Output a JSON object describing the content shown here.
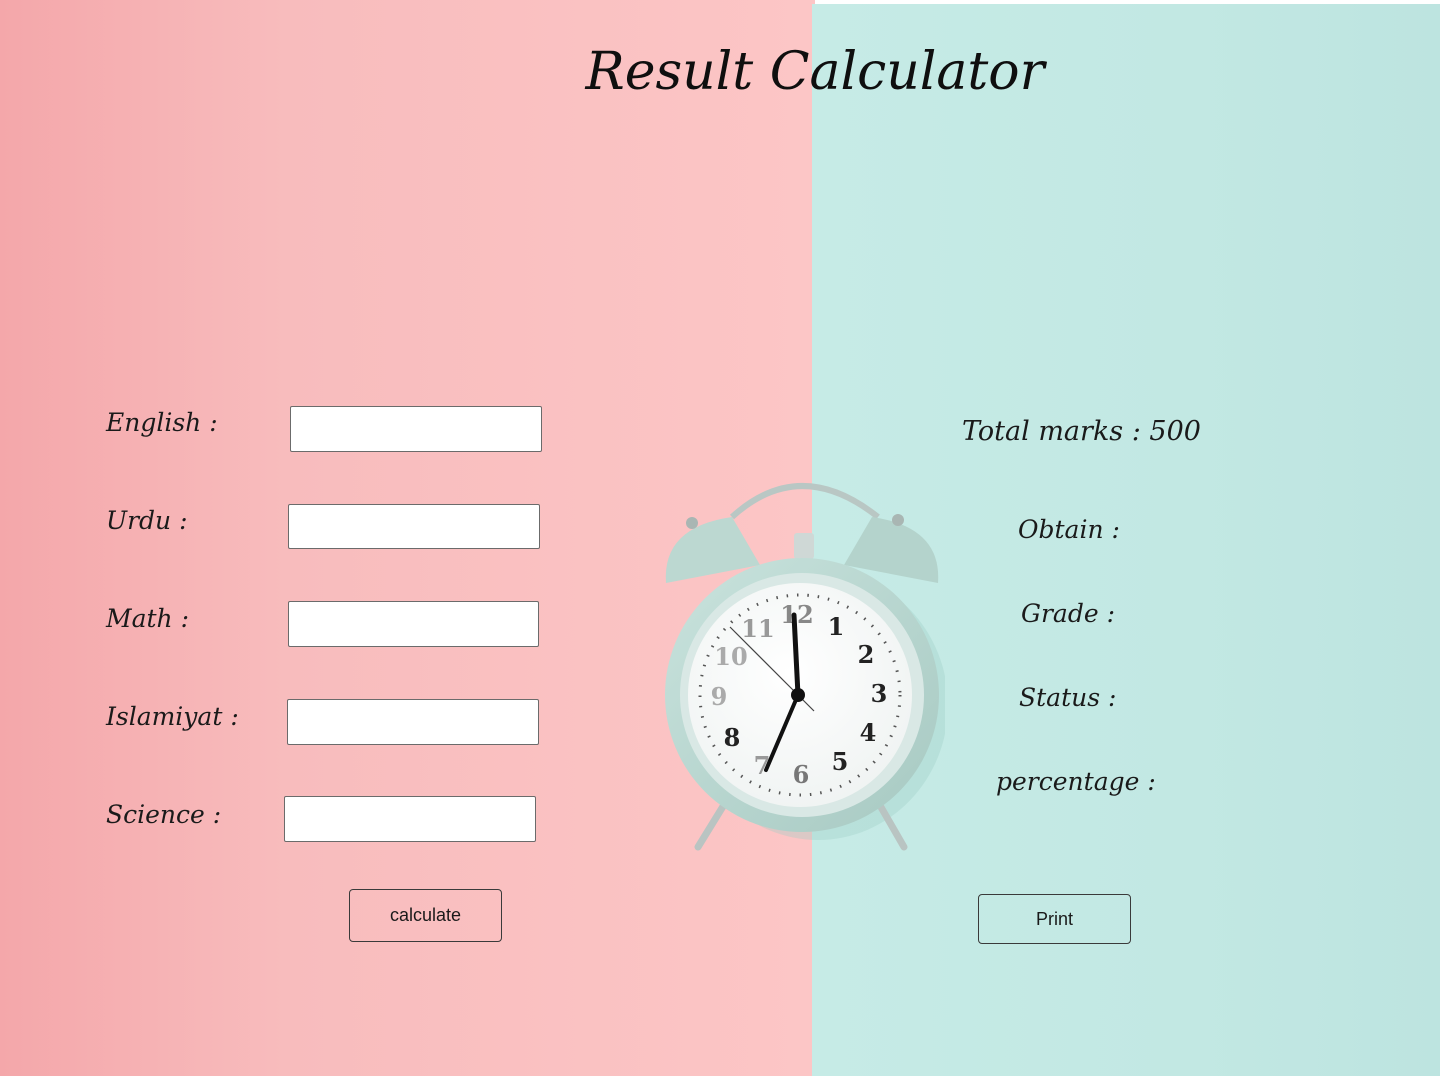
{
  "title": "Result Calculator",
  "form": {
    "english_label": "English :",
    "urdu_label": "Urdu :",
    "math_label": "Math :",
    "islamiyat_label": "Islamiyat :",
    "science_label": "Science :",
    "english_value": "",
    "urdu_value": "",
    "math_value": "",
    "islamiyat_value": "",
    "science_value": "",
    "calculate_label": "calculate"
  },
  "result": {
    "total_label": "Total marks : 500",
    "obtain_label": "Obtain :",
    "grade_label": "Grade :",
    "status_label": "Status :",
    "percentage_label": "percentage :",
    "print_label": "Print"
  },
  "colors": {
    "left_background": "#f9bfc0",
    "right_background": "#c4e9e4",
    "clock_body": "#bcd8d1"
  },
  "icons": {
    "clock": "alarm-clock-icon"
  }
}
